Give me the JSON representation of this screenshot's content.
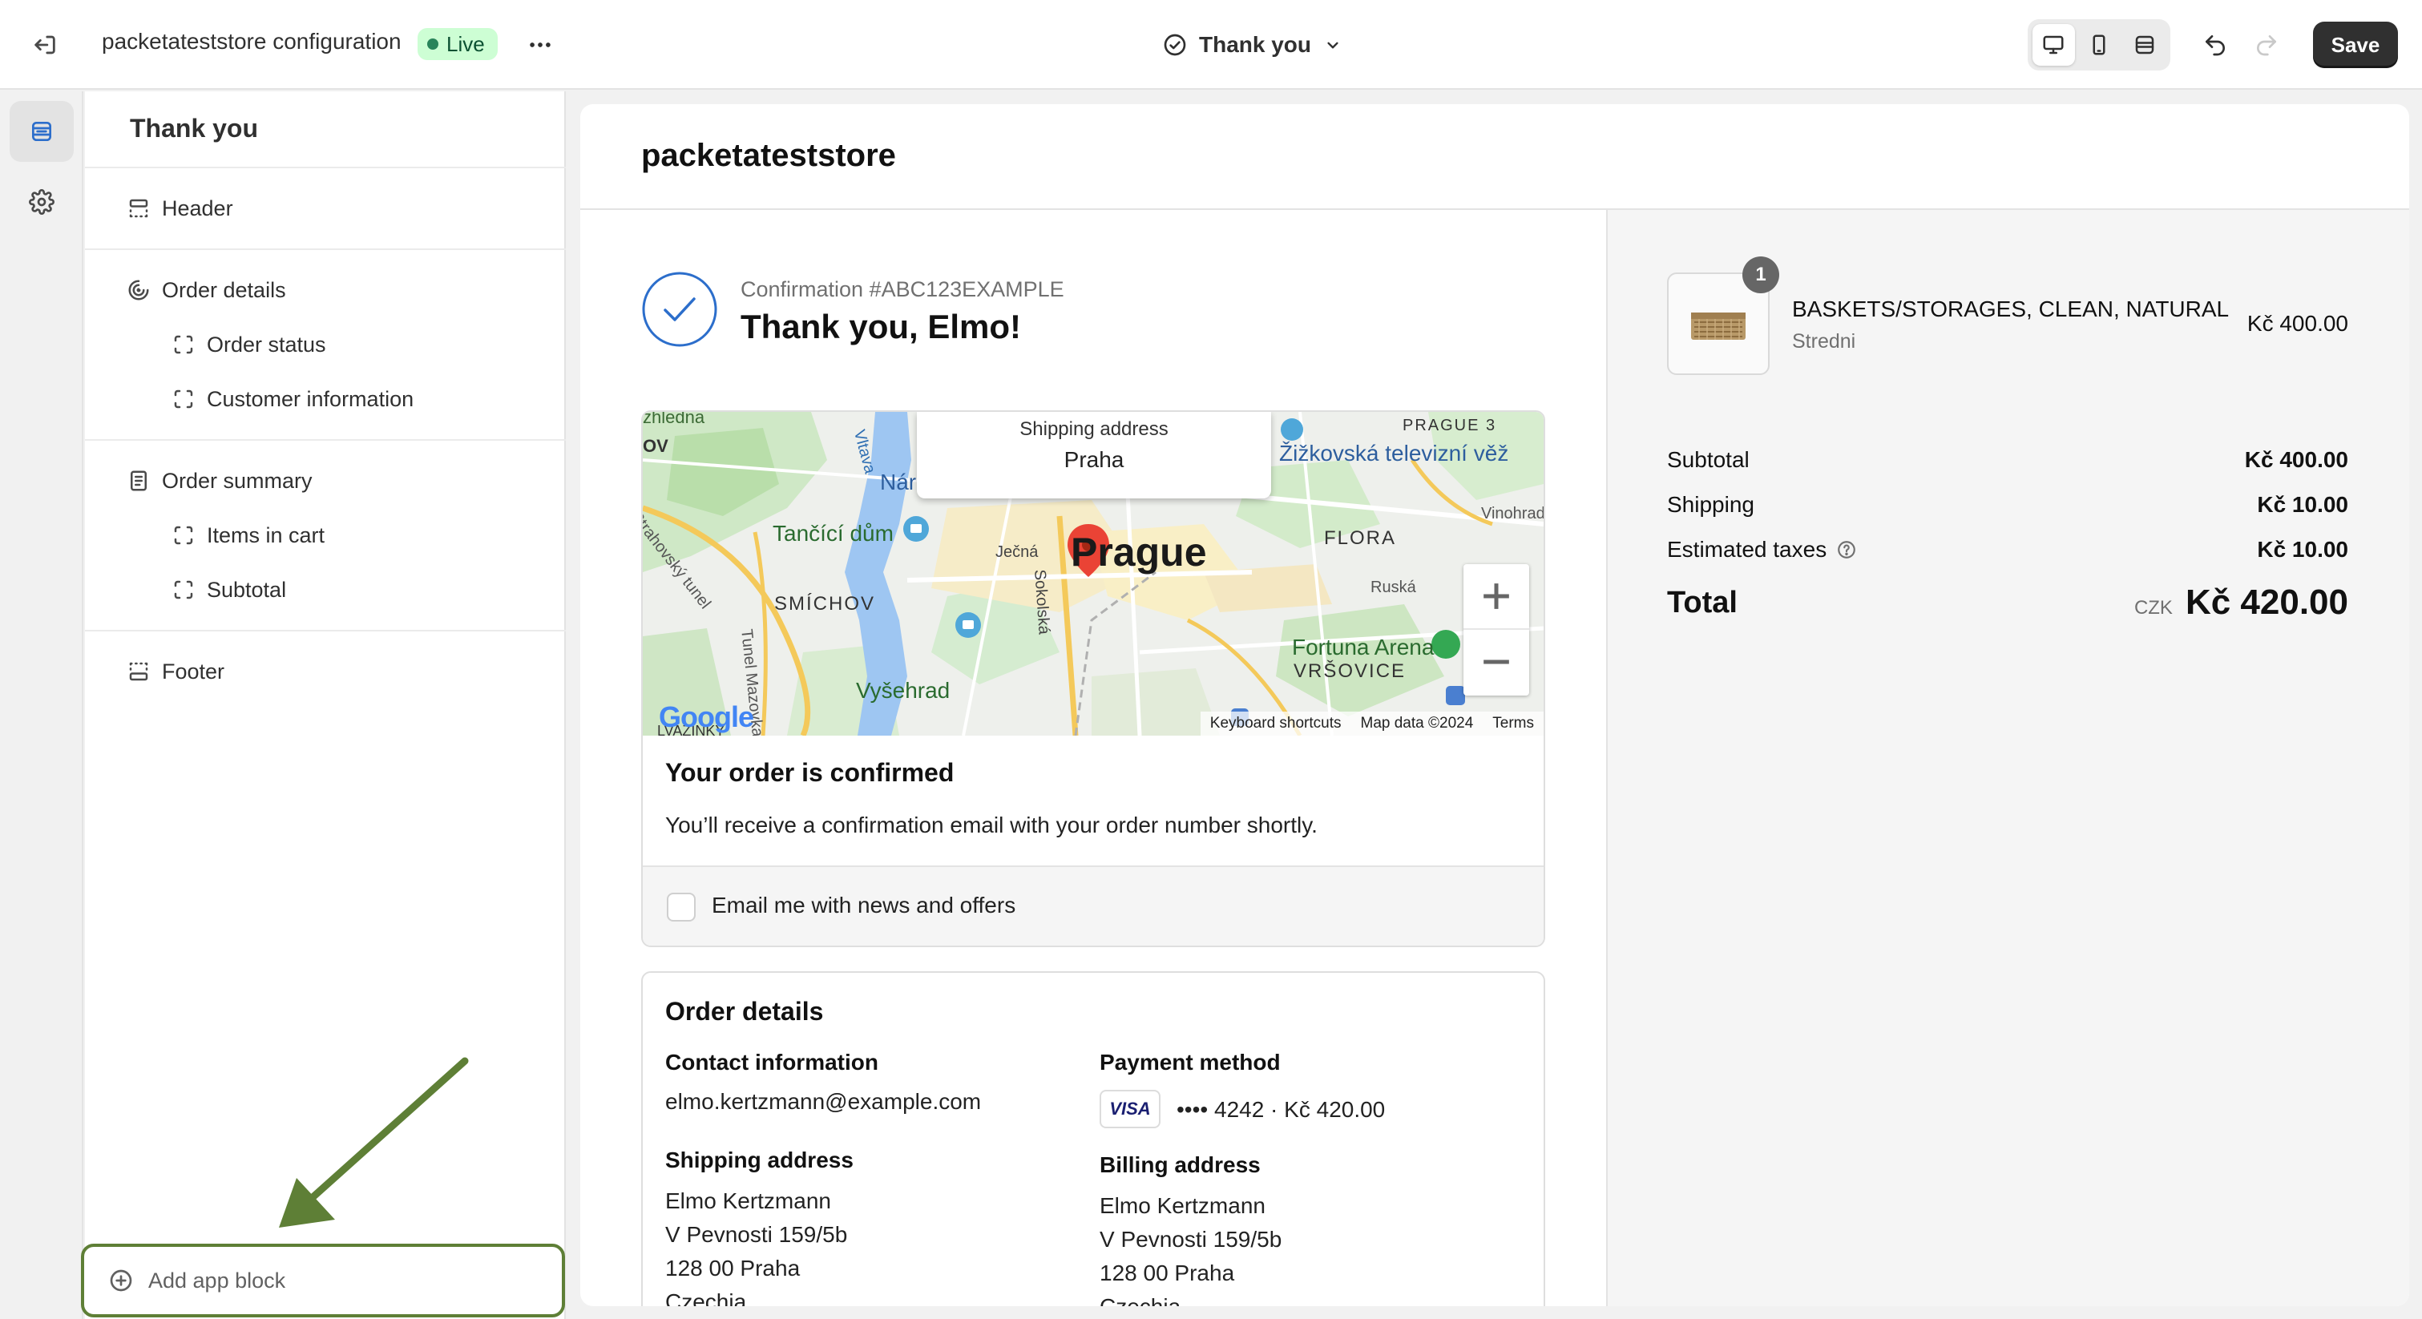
{
  "topbar": {
    "store_title": "packetateststore configuration",
    "live_badge": "Live",
    "page_selector": "Thank you",
    "save_label": "Save"
  },
  "sidebar": {
    "title": "Thank you",
    "sections": [
      {
        "label": "Header",
        "icon": "header-layout-icon"
      },
      {
        "label": "Order details",
        "icon": "order-details-icon",
        "children": [
          "Order status",
          "Customer information"
        ]
      },
      {
        "label": "Order summary",
        "icon": "receipt-icon",
        "children": [
          "Items in cart",
          "Subtotal"
        ]
      },
      {
        "label": "Footer",
        "icon": "footer-layout-icon"
      }
    ],
    "add_app_block": "Add app block"
  },
  "preview": {
    "store_name": "packetateststore",
    "confirmation_number": "Confirmation #ABC123EXAMPLE",
    "thank_you": "Thank you, Elmo!",
    "map": {
      "popup_title": "Shipping address",
      "popup_city": "Praha",
      "labels": {
        "city": "Prague",
        "zizkov": "Žižkovská televizní věž",
        "tanci": "Tančící dům",
        "smichov": "SMÍCHOV",
        "flora": "FLORA",
        "vysehrad": "Vyšehrad",
        "fortuna": "Fortuna Arena",
        "vrsovice": "VRŠOVICE",
        "praha3": "PRAGUE 3",
        "vinohrad": "Vinohrad",
        "ruska": "Ruská",
        "jecna": "Ječná",
        "sokolska": "Sokolská",
        "strahov": "Strahovský tunel",
        "mazovka": "Tunel Mazovka",
        "vltava": "Vltava",
        "nar": "Nár",
        "nedna": "zhledna",
        "ov": "OV",
        "vazinky": "LVAZINKY"
      },
      "google": "Google",
      "keyboard_shortcuts": "Keyboard shortcuts",
      "map_data": "Map data ©2024",
      "terms": "Terms"
    },
    "confirmed_title": "Your order is confirmed",
    "confirmed_text": "You’ll receive a confirmation email with your order number shortly.",
    "email_optin": "Email me with news and offers",
    "order_details": {
      "title": "Order details",
      "contact_heading": "Contact information",
      "contact_email": "elmo.kertzmann@example.com",
      "payment_heading": "Payment method",
      "card_brand": "VISA",
      "payment_text": "•••• 4242 · Kč 420.00",
      "shipping_heading": "Shipping address",
      "shipping_lines": [
        "Elmo Kertzmann",
        "V Pevnosti 159/5b",
        "128 00 Praha",
        "Czechia"
      ],
      "billing_heading": "Billing address",
      "billing_lines": [
        "Elmo Kertzmann",
        "V Pevnosti 159/5b",
        "128 00 Praha",
        "Czechia"
      ]
    },
    "summary": {
      "quantity": "1",
      "product_name": "BASKETS/STORAGES, CLEAN, NATURAL",
      "product_variant": "Stredni",
      "product_price": "Kč 400.00",
      "subtotal_label": "Subtotal",
      "subtotal_value": "Kč 400.00",
      "shipping_label": "Shipping",
      "shipping_value": "Kč 10.00",
      "taxes_label": "Estimated taxes",
      "taxes_value": "Kč 10.00",
      "total_label": "Total",
      "total_currency": "CZK",
      "total_value": "Kč 420.00"
    }
  },
  "colors": {
    "live_bg": "#cdfed4",
    "accent_blue": "#2c6ecb",
    "annotation_green": "#5e7f36",
    "save_bg": "#303030"
  }
}
